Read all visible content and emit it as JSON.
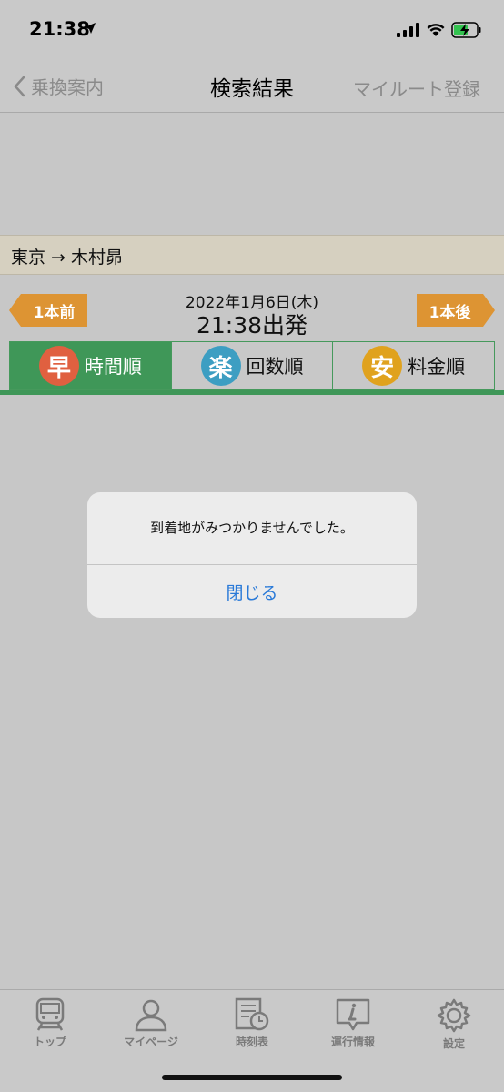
{
  "status": {
    "time": "21:38"
  },
  "nav": {
    "back_label": "乗換案内",
    "title": "検索結果",
    "right_label": "マイルート登録"
  },
  "route": {
    "text": "東京 → 木村昴"
  },
  "search": {
    "prev_label": "1本前",
    "next_label": "1本後",
    "date": "2022年1月6日(木)",
    "departure": "21:38出発"
  },
  "sort_tabs": [
    {
      "badge": "早",
      "label": "時間順",
      "color": "#e06040",
      "active": true
    },
    {
      "badge": "楽",
      "label": "回数順",
      "color": "#3d9ec2",
      "active": false
    },
    {
      "badge": "安",
      "label": "料金順",
      "color": "#e0a21e",
      "active": false
    }
  ],
  "alert": {
    "message": "到着地がみつかりませんでした。",
    "close_label": "閉じる"
  },
  "tabbar": {
    "items": [
      {
        "label": "トップ",
        "icon": "train-icon"
      },
      {
        "label": "マイページ",
        "icon": "person-icon"
      },
      {
        "label": "時刻表",
        "icon": "timetable-icon"
      },
      {
        "label": "運行情報",
        "icon": "info-icon"
      },
      {
        "label": "設定",
        "icon": "gear-icon"
      }
    ]
  },
  "colors": {
    "accent_green": "#3f9758",
    "orange": "#dd9433",
    "alert_blue": "#2a7ad8"
  }
}
